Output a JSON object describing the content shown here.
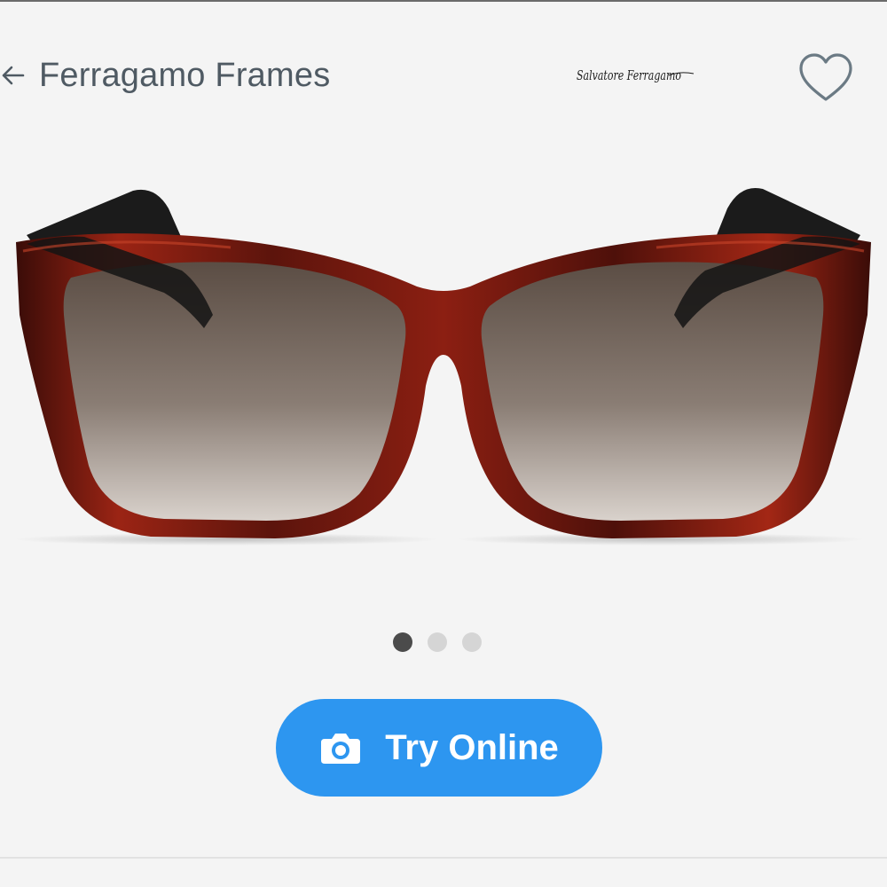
{
  "header": {
    "title": "Ferragamo Frames",
    "brand_logo_text": "Salvatore Ferragamo",
    "back_icon": "arrow-left-icon",
    "favorite_icon": "heart-outline-icon"
  },
  "gallery": {
    "image_count": 3,
    "active_index": 0,
    "frame_color": "#8f1f14",
    "lens_color": "#6a5a50"
  },
  "actions": {
    "try_online_label": "Try Online",
    "try_online_icon": "camera-icon",
    "accent_color": "#2d96f0"
  }
}
